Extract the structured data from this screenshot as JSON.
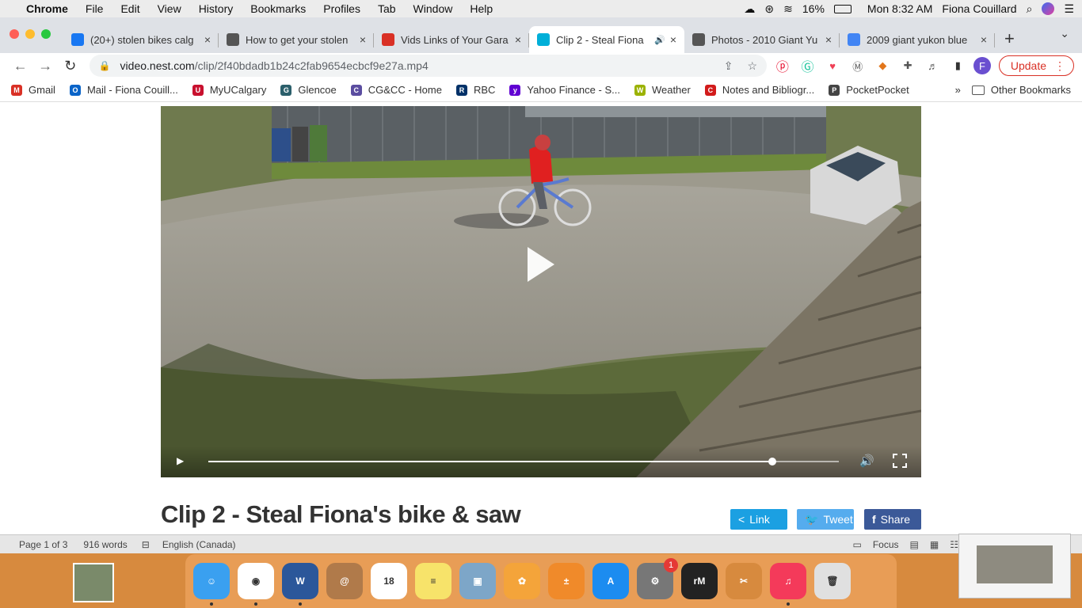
{
  "menubar": {
    "app": "Chrome",
    "items": [
      "File",
      "Edit",
      "View",
      "History",
      "Bookmarks",
      "Profiles",
      "Tab",
      "Window",
      "Help"
    ],
    "battery": "16%",
    "clock": "Mon 8:32 AM",
    "user": "Fiona Couillard"
  },
  "tabs": [
    {
      "label": "(20+) stolen bikes calg",
      "icon": "facebook-icon",
      "color": "#1877f2"
    },
    {
      "label": "How to get your stolen",
      "icon": "shield-icon",
      "color": "#555555"
    },
    {
      "label": "Vids Links of Your Gara",
      "icon": "gmail-icon",
      "color": "#d93025"
    },
    {
      "label": "Clip 2 - Steal Fiona",
      "icon": "nest-icon",
      "color": "#00afd8",
      "active": true
    },
    {
      "label": "Photos - 2010 Giant Yu",
      "icon": "shield-icon",
      "color": "#555555"
    },
    {
      "label": "2009 giant yukon blue",
      "icon": "google-icon",
      "color": "#4285f4"
    }
  ],
  "omnibox": {
    "domain": "video.nest.com",
    "path": "/clip/2f40bdadb1b24c2fab9654ecbcf9e27a.mp4"
  },
  "toolbar": {
    "update_label": "Update",
    "profile_initial": "F"
  },
  "bookmarks": [
    {
      "label": "Gmail",
      "color": "#d93025",
      "glyph": "M"
    },
    {
      "label": "Mail - Fiona Couill...",
      "color": "#0a64c8",
      "glyph": "O"
    },
    {
      "label": "MyUCalgary",
      "color": "#c8102e",
      "glyph": "U"
    },
    {
      "label": "Glencoe",
      "color": "#2b5f6b",
      "glyph": "G"
    },
    {
      "label": "CG&CC - Home",
      "color": "#5b4da0",
      "glyph": "C"
    },
    {
      "label": "RBC",
      "color": "#003168",
      "glyph": "R"
    },
    {
      "label": "Yahoo Finance - S...",
      "color": "#6001d2",
      "glyph": "y"
    },
    {
      "label": "Weather",
      "color": "#9bb200",
      "glyph": "W"
    },
    {
      "label": "Notes and Bibliogr...",
      "color": "#d21b1b",
      "glyph": "C"
    },
    {
      "label": "PocketPocket",
      "color": "#444444",
      "glyph": "P"
    }
  ],
  "bookmarks_overflow": "»",
  "other_bookmarks": "Other Bookmarks",
  "video": {
    "progress": 0.895
  },
  "clip_title": "Clip 2 - Steal Fiona's bike & saw",
  "share_buttons": {
    "link": "Link",
    "tweet": "Tweet",
    "share": "Share"
  },
  "word_status": {
    "page": "Page 1 of 3",
    "words": "916 words",
    "language": "English (Canada)",
    "focus": "Focus"
  },
  "dock": [
    {
      "name": "finder-icon",
      "color": "#3aa0f0",
      "glyph": "☺",
      "running": true
    },
    {
      "name": "chrome-icon",
      "color": "#ffffff",
      "glyph": "◉",
      "running": true
    },
    {
      "name": "word-icon",
      "color": "#2b579a",
      "glyph": "W",
      "running": true
    },
    {
      "name": "contacts-icon",
      "color": "#b07a4a",
      "glyph": "@",
      "running": false
    },
    {
      "name": "calendar-icon",
      "color": "#ffffff",
      "glyph": "18",
      "running": false
    },
    {
      "name": "notes-icon",
      "color": "#f7e36a",
      "glyph": "≡",
      "running": false
    },
    {
      "name": "preview-icon",
      "color": "#7da6c8",
      "glyph": "▣",
      "running": false
    },
    {
      "name": "photos-icon",
      "color": "#f4a43a",
      "glyph": "✿",
      "running": false
    },
    {
      "name": "calculator-icon",
      "color": "#f08a2a",
      "glyph": "±",
      "running": false
    },
    {
      "name": "app-store-icon",
      "color": "#1c8cf0",
      "glyph": "A",
      "running": false
    },
    {
      "name": "system-preferences-icon",
      "color": "#777777",
      "glyph": "⚙",
      "running": false,
      "badge": "1"
    },
    {
      "name": "remarkable-icon",
      "color": "#222222",
      "glyph": "rM",
      "running": false
    },
    {
      "name": "scissors-icon",
      "color": "#d78a3e",
      "glyph": "✂",
      "running": false
    },
    {
      "name": "music-icon",
      "color": "#f43a5a",
      "glyph": "♫",
      "running": true
    },
    {
      "name": "trash-icon",
      "color": "#e0e0e0",
      "glyph": "🗑",
      "running": false
    }
  ]
}
